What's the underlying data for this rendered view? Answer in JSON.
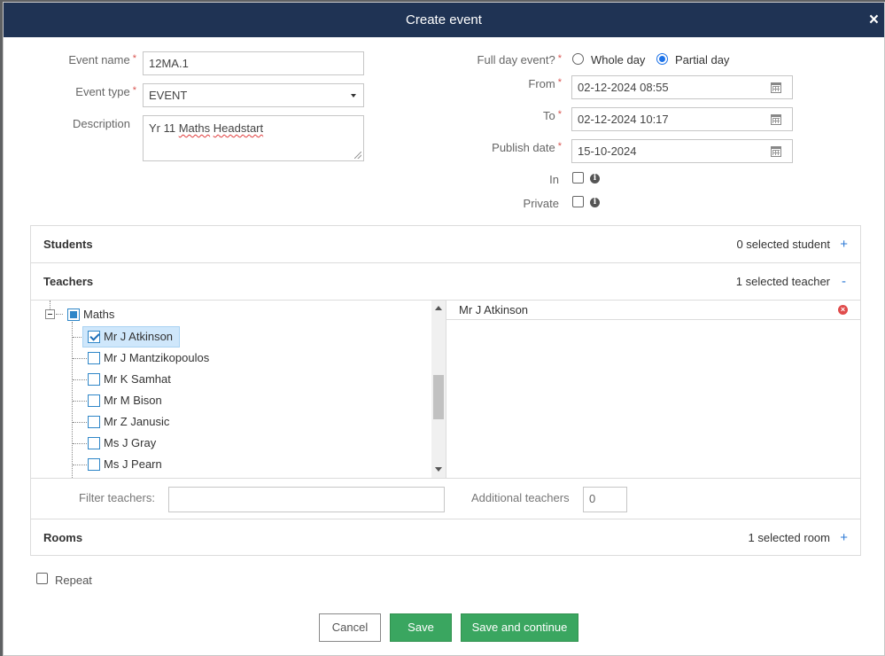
{
  "modal": {
    "title": "Create event",
    "close_label": "×"
  },
  "form": {
    "event_name": {
      "label": "Event name",
      "value": "12MA.1"
    },
    "event_type": {
      "label": "Event type",
      "value": "EVENT"
    },
    "description": {
      "label": "Description",
      "value_prefix": "Yr 11 ",
      "value_word1": "Maths",
      "value_space": " ",
      "value_word2": "Headstart"
    },
    "full_day": {
      "label": "Full day event?",
      "option_whole": "Whole day",
      "option_partial": "Partial day",
      "selected": "Partial day"
    },
    "from": {
      "label": "From",
      "value": "02-12-2024 08:55"
    },
    "to": {
      "label": "To",
      "value": "02-12-2024 10:17"
    },
    "publish_date": {
      "label": "Publish date",
      "value": "15-10-2024"
    },
    "in": {
      "label": "In"
    },
    "private": {
      "label": "Private"
    },
    "required_mark": "*"
  },
  "students": {
    "title": "Students",
    "count": "0 selected student",
    "toggle": "+"
  },
  "teachers": {
    "title": "Teachers",
    "count": "1 selected teacher",
    "toggle": "-",
    "tree": {
      "group": "Maths",
      "items": [
        {
          "name": "Mr J Atkinson",
          "checked": true
        },
        {
          "name": "Mr J Mantzikopoulos",
          "checked": false
        },
        {
          "name": "Mr K Samhat",
          "checked": false
        },
        {
          "name": "Mr M Bison",
          "checked": false
        },
        {
          "name": "Mr Z Janusic",
          "checked": false
        },
        {
          "name": "Ms J Gray",
          "checked": false
        },
        {
          "name": "Ms J Pearn",
          "checked": false
        }
      ]
    },
    "selected": [
      "Mr J Atkinson"
    ],
    "filter_label": "Filter teachers:",
    "filter_value": "",
    "additional_label": "Additional teachers",
    "additional_value": "0"
  },
  "rooms": {
    "title": "Rooms",
    "count": "1 selected room",
    "toggle": "+"
  },
  "repeat": {
    "label": "Repeat"
  },
  "buttons": {
    "cancel": "Cancel",
    "save": "Save",
    "save_continue": "Save and continue"
  },
  "colors": {
    "header_bg": "#1f3354",
    "accent_blue": "#1e73e8",
    "save_green": "#3aa660",
    "remove_red": "#e04b4b"
  }
}
